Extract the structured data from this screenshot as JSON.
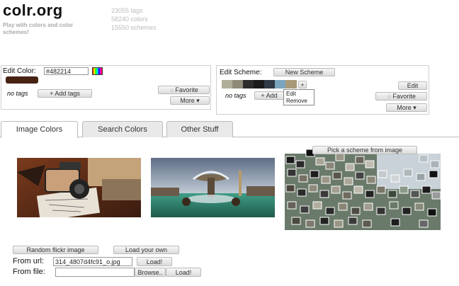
{
  "header": {
    "logo": "colr.org",
    "tagline": "Play with colors and color schemes!",
    "stats": [
      "23055 tags",
      "58240 colors",
      "15550 schemes"
    ]
  },
  "edit_color": {
    "label": "Edit Color:",
    "value": "#482214",
    "swatch_color": "#482214",
    "no_tags": "no tags",
    "add_tags": "+ Add tags",
    "favorite": "Favorite",
    "more": "More ▾"
  },
  "edit_scheme": {
    "label": "Edit Scheme:",
    "new_scheme": "New Scheme",
    "swatches": [
      "#b0ae98",
      "#8e8a78",
      "#2c2c2c",
      "#1a1a1a",
      "#2e3a44",
      "#7aa5bf",
      "#a89a78"
    ],
    "no_tags": "no tags",
    "add_tags": "+ Add",
    "plus": "+",
    "menu": [
      "Edit",
      "Remove"
    ],
    "edit": "Edit",
    "favorite": "Favorite",
    "more": "More ▾"
  },
  "tabs": [
    {
      "label": "Image Colors",
      "active": true
    },
    {
      "label": "Search Colors",
      "active": false
    },
    {
      "label": "Other Stuff",
      "active": false
    }
  ],
  "images": {
    "pick_scheme": "Pick a scheme from image"
  },
  "actions": {
    "random": "Random flickr image",
    "load_own": "Load your own",
    "from_url_label": "From url:",
    "url_value": "314_4807d4fc91_o.jpg",
    "load": "Load!",
    "from_file_label": "From file:",
    "browse": "Browse..",
    "load2": "Load!"
  }
}
